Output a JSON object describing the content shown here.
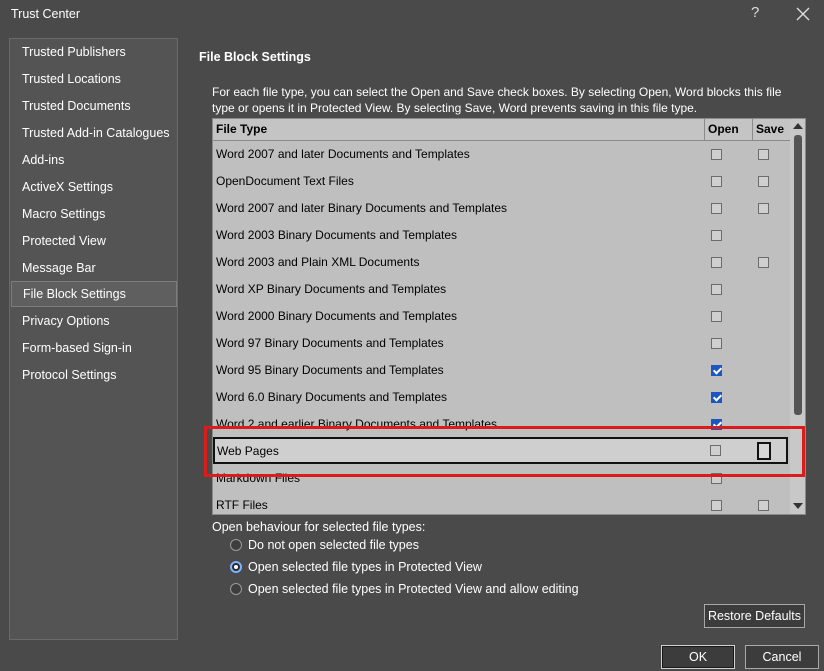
{
  "window": {
    "title": "Trust Center",
    "help": "?"
  },
  "nav": {
    "items": [
      {
        "label": "Trusted Publishers"
      },
      {
        "label": "Trusted Locations"
      },
      {
        "label": "Trusted Documents"
      },
      {
        "label": "Trusted Add-in Catalogues"
      },
      {
        "label": "Add-ins"
      },
      {
        "label": "ActiveX Settings"
      },
      {
        "label": "Macro Settings"
      },
      {
        "label": "Protected View"
      },
      {
        "label": "Message Bar"
      },
      {
        "label": "File Block Settings",
        "selected": true
      },
      {
        "label": "Privacy Options"
      },
      {
        "label": "Form-based Sign-in"
      },
      {
        "label": "Protocol Settings"
      }
    ]
  },
  "section": {
    "title": "File Block Settings",
    "description": "For each file type, you can select the Open and Save check boxes. By selecting Open, Word blocks this file type or opens it in Protected View. By selecting Save, Word prevents saving in this file type."
  },
  "grid": {
    "columns": [
      "File Type",
      "Open",
      "Save"
    ],
    "rows": [
      {
        "name": "Word 2007 and later Documents and Templates",
        "open": false,
        "save": false
      },
      {
        "name": "OpenDocument Text Files",
        "open": false,
        "save": false
      },
      {
        "name": "Word 2007 and later Binary Documents and Templates",
        "open": false,
        "save": false
      },
      {
        "name": "Word 2003 Binary Documents and Templates",
        "open": false,
        "save": null
      },
      {
        "name": "Word 2003 and Plain XML Documents",
        "open": false,
        "save": false
      },
      {
        "name": "Word XP Binary Documents and Templates",
        "open": false,
        "save": null
      },
      {
        "name": "Word 2000 Binary Documents and Templates",
        "open": false,
        "save": null
      },
      {
        "name": "Word 97 Binary Documents and Templates",
        "open": false,
        "save": null
      },
      {
        "name": "Word 95 Binary Documents and Templates",
        "open": true,
        "save": null
      },
      {
        "name": "Word 6.0 Binary Documents and Templates",
        "open": true,
        "save": null
      },
      {
        "name": "Word 2 and earlier Binary Documents and Templates",
        "open": true,
        "save": null
      },
      {
        "name": "Web Pages",
        "open": false,
        "save": false,
        "focused": true
      },
      {
        "name": "Markdown Files",
        "open": false,
        "save": null
      },
      {
        "name": "RTF Files",
        "open": false,
        "save": false
      }
    ]
  },
  "behaviour": {
    "label": "Open behaviour for selected file types:",
    "options": [
      {
        "label": "Do not open selected file types",
        "selected": false
      },
      {
        "label": "Open selected file types in Protected View",
        "selected": true
      },
      {
        "label": "Open selected file types in Protected View and allow editing",
        "selected": false
      }
    ]
  },
  "buttons": {
    "restore": "Restore Defaults",
    "ok": "OK",
    "cancel": "Cancel"
  },
  "colors": {
    "background": "#4a4a4a",
    "grid": "#bfbfbf",
    "check": "#1a56c4",
    "highlight": "#d91c1c"
  }
}
